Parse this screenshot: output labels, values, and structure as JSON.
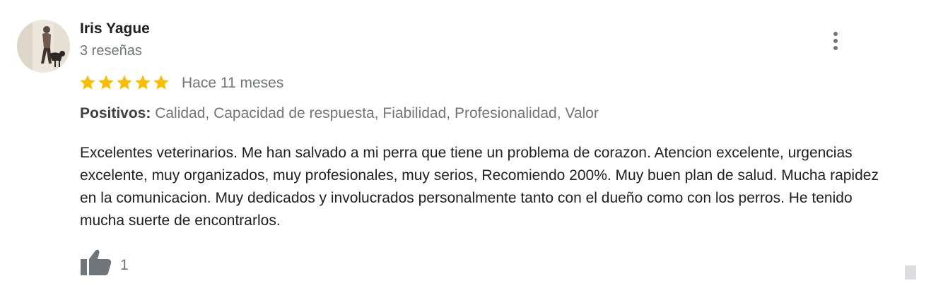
{
  "review": {
    "author_name": "Iris Yague",
    "review_count": "3 reseñas",
    "rating": 5,
    "rating_max": 5,
    "date": "Hace 11 meses",
    "positives_label": "Positivos:",
    "positives_list": " Calidad, Capacidad de respuesta, Fiabilidad, Profesionalidad, Valor",
    "text": "Excelentes veterinarios. Me han salvado a mi perra que tiene un problema de corazon. Atencion excelente, urgencias excelente, muy organizados, muy profesionales, muy serios, Recomiendo 200%. Muy buen plan de salud. Mucha rapidez en la comunicacion. Muy dedicados y involucrados personalmente tanto con el dueño como con los perros. He tenido mucha suerte de encontrarlos.",
    "like_count": "1"
  },
  "icons": {
    "star": "star-icon",
    "more": "more-vert-icon",
    "like": "thumb-up-icon"
  },
  "colors": {
    "star": "#fbbc04",
    "secondary_text": "#70757a",
    "primary_text": "#202124",
    "icon": "#70757a"
  }
}
